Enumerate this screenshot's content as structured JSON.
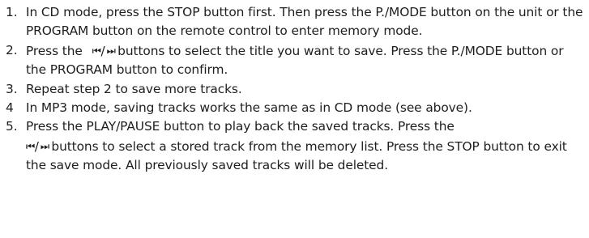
{
  "steps": [
    {
      "number": "1.",
      "text": "In CD mode, press the STOP button first. Then press the P./MODE button on the unit or the PROGRAM button on the remote control to enter memory mode."
    },
    {
      "number": "2.",
      "prefix": "Press the",
      "icon_prev": "⏮",
      "icon_sep": "/",
      "icon_next": "⏭",
      "suffix": " buttons to select the title you want to save. Press the P./MODE button or the PROGRAM button to confirm."
    },
    {
      "number": "3.",
      "text": "Repeat step 2 to save more tracks."
    },
    {
      "number": "4",
      "text": "In MP3 mode, saving tracks works the same as in CD mode (see above)."
    },
    {
      "number": "5.",
      "prefix": "Press the PLAY/PAUSE button to play back the saved tracks. Press the ",
      "icon_prev": "⏮",
      "icon_sep": "/",
      "icon_next": "⏭",
      "suffix": " buttons to select a stored track from the memory list. Press the STOP button to exit the save mode. All previously saved tracks will be deleted."
    }
  ],
  "icons": {
    "prev": "skip-previous-icon",
    "next": "skip-next-icon"
  }
}
